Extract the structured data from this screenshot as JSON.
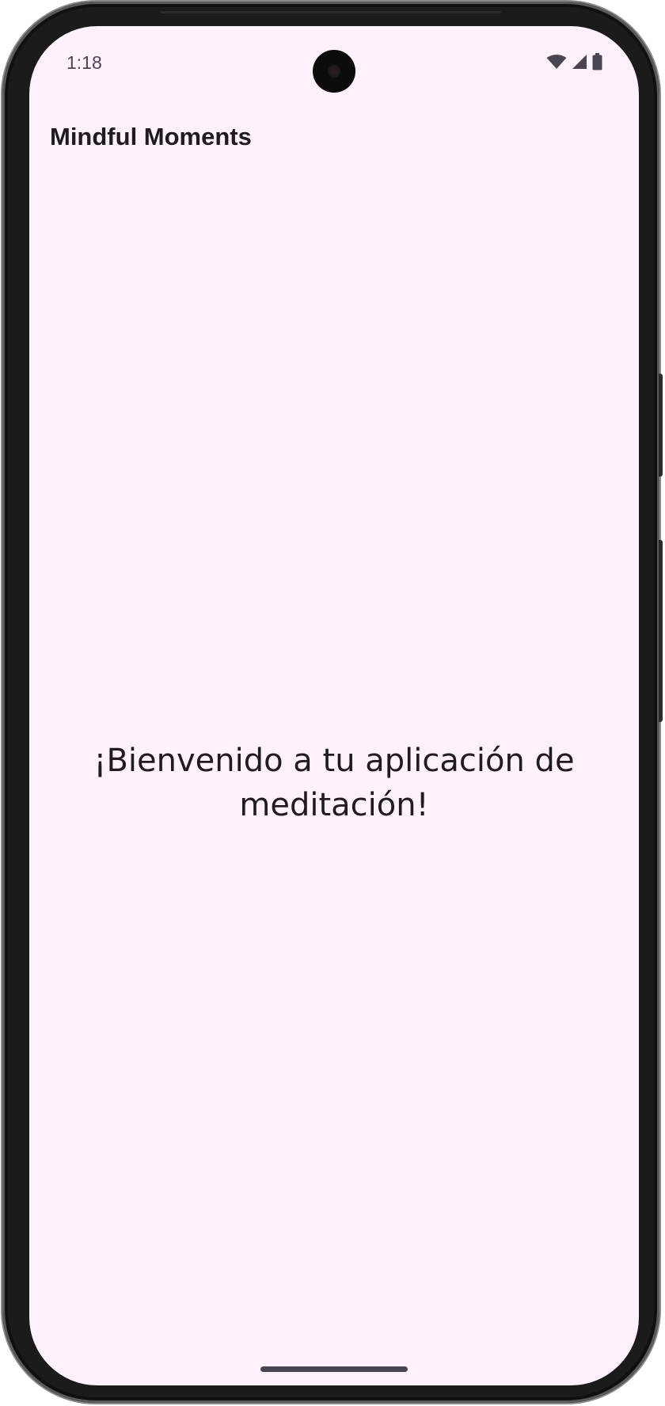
{
  "status_bar": {
    "time": "1:18",
    "icons": [
      "wifi-icon",
      "cellular-signal-icon",
      "battery-icon"
    ]
  },
  "app_bar": {
    "title": "Mindful Moments"
  },
  "main": {
    "welcome_message": "¡Bienvenido a tu aplicación de meditación!"
  },
  "colors": {
    "background": "#fdf2fc",
    "text": "#1f1b20",
    "status_text": "#4a4550"
  }
}
